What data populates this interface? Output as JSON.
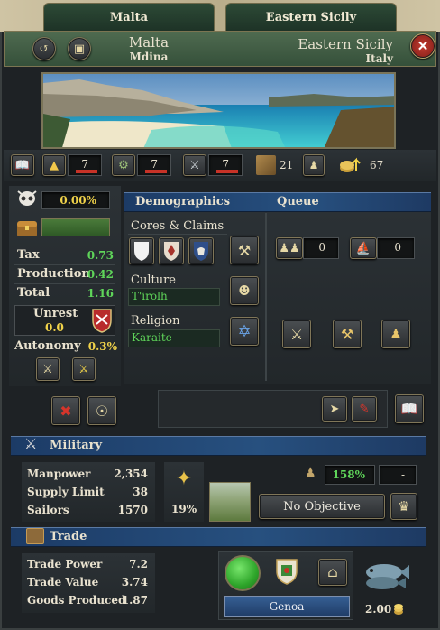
{
  "tabs": {
    "left": "Malta",
    "right": "Eastern Sicily"
  },
  "header": {
    "province": "Malta",
    "capital": "Mdina",
    "state": "Eastern Sicily",
    "country": "Italy"
  },
  "dev_row": {
    "tax": "7",
    "production": "7",
    "manpower": "7",
    "buildings": "21",
    "trade_goods": "67"
  },
  "overview": {
    "separatism": "0.00%",
    "rows": [
      {
        "label": "Tax",
        "value": "0.73"
      },
      {
        "label": "Production",
        "value": "0.42"
      },
      {
        "label": "Total",
        "value": "1.16"
      }
    ],
    "unrest_label": "Unrest",
    "unrest_value": "0.0",
    "autonomy_label": "Autonomy",
    "autonomy_value": "0.3%"
  },
  "demographics": {
    "title": "Demographics",
    "queue_title": "Queue",
    "cores_label": "Cores & Claims",
    "culture_label": "Culture",
    "culture_value": "T'irolh",
    "religion_label": "Religion",
    "religion_value": "Karaite",
    "queue_units": "0",
    "queue_ships": "0"
  },
  "military": {
    "title": "Military",
    "rows": [
      {
        "label": "Manpower",
        "value": "2,354"
      },
      {
        "label": "Supply Limit",
        "value": "38"
      },
      {
        "label": "Sailors",
        "value": "1570"
      }
    ],
    "fort_percent": "19%",
    "garrison": "158%",
    "garrison_extra": "-",
    "objective": "No Objective"
  },
  "trade": {
    "title": "Trade",
    "rows": [
      {
        "label": "Trade Power",
        "value": "7.2"
      },
      {
        "label": "Trade Value",
        "value": "3.74"
      },
      {
        "label": "Goods Produced",
        "value": "1.87"
      }
    ],
    "node": "Genoa",
    "income": "2.00"
  },
  "colors": {
    "accent_blue": "#27507f",
    "positive_green": "#5fd55a",
    "highlight_yellow": "#f1d34a",
    "header_green": "#3f5a42"
  }
}
